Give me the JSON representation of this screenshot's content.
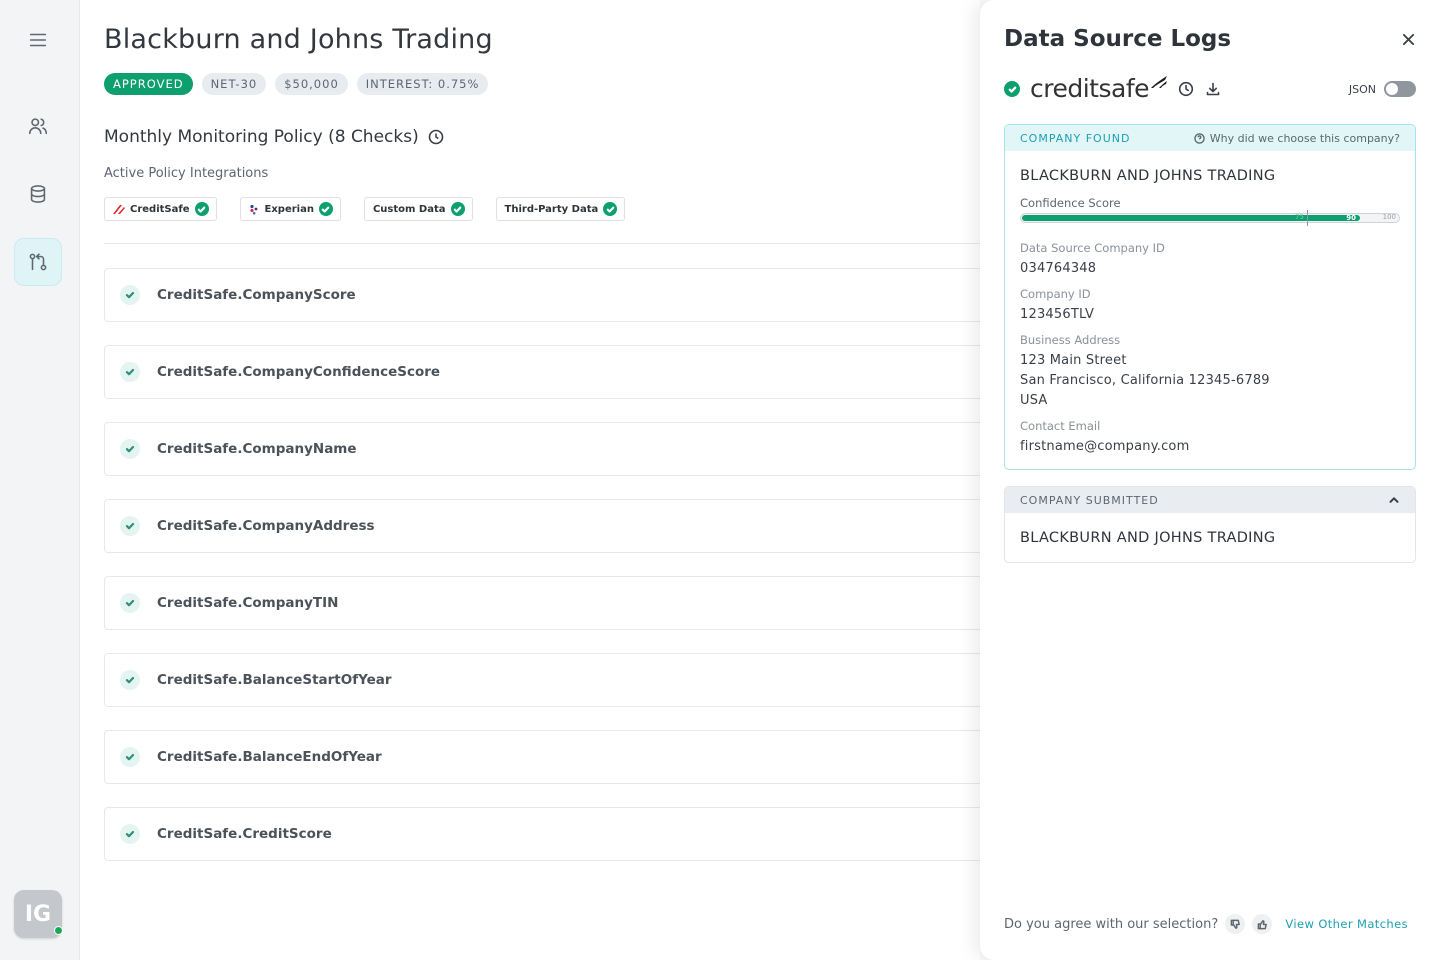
{
  "sidebar": {
    "items": [
      {
        "icon": "menu-icon"
      },
      {
        "icon": "users-icon"
      },
      {
        "icon": "database-icon"
      },
      {
        "icon": "git-compare-icon",
        "active": true
      }
    ],
    "avatar": {
      "initials": "IG",
      "status": "online"
    }
  },
  "company": {
    "name": "Blackburn and Johns Trading",
    "tags": [
      {
        "label": "APPROVED",
        "type": "status"
      },
      {
        "label": "NET-30"
      },
      {
        "label": "$50,000"
      },
      {
        "label": "INTEREST: 0.75%"
      }
    ]
  },
  "policy": {
    "title": "Monthly Monitoring Policy (8 Checks)",
    "integrations_label": "Active Policy Integrations",
    "integrations": [
      {
        "label": "CreditSafe",
        "icon": "creditsafe-logo-icon"
      },
      {
        "label": "Experian",
        "icon": "experian-logo-icon"
      },
      {
        "label": "Custom Data"
      },
      {
        "label": "Third-Party Data"
      }
    ],
    "checks": [
      "CreditSafe.CompanyScore",
      "CreditSafe.CompanyConfidenceScore",
      "CreditSafe.CompanyName",
      "CreditSafe.CompanyAddress",
      "CreditSafe.CompanyTIN",
      "CreditSafe.BalanceStartOfYear",
      "CreditSafe.BalanceEndOfYear",
      "CreditSafe.CreditScore"
    ]
  },
  "panel": {
    "title": "Data Source Logs",
    "source_logo_text": "creditsafe",
    "json_label": "JSON",
    "json_enabled": false,
    "found": {
      "header": "COMPANY FOUND",
      "why_link": "Why did we choose this company?",
      "company_name": "BLACKBURN AND JOHNS TRADING",
      "confidence": {
        "label": "Confidence Score",
        "value": 90,
        "threshold": 75,
        "max": 100,
        "value_text": "90",
        "threshold_text": "75",
        "max_text": "100"
      },
      "fields": {
        "ds_id": {
          "label": "Data Source Company ID",
          "value": "034764348"
        },
        "company_id": {
          "label": "Company ID",
          "value": "123456TLV"
        },
        "address": {
          "label": "Business Address",
          "line1": "123 Main Street",
          "line2": "San Francisco, California 12345-6789",
          "line3": "USA"
        },
        "email": {
          "label": "Contact Email",
          "value": "firstname@company.com"
        }
      }
    },
    "submitted": {
      "header": "COMPANY SUBMITTED",
      "company_name": "BLACKBURN AND JOHNS TRADING"
    },
    "footer": {
      "question": "Do you agree with our selection?",
      "view_link": "View Other Matches"
    }
  }
}
